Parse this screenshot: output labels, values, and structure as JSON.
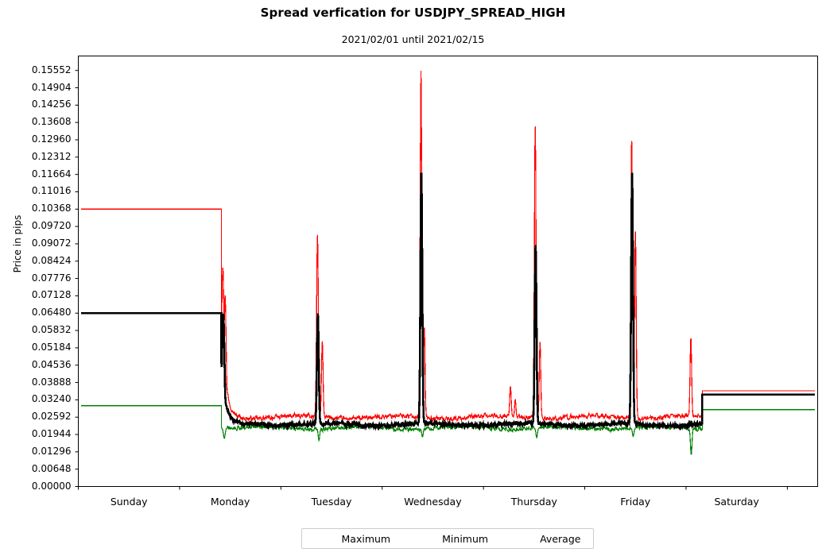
{
  "chart_data": {
    "type": "line",
    "title": "Spread verfication for USDJPY_SPREAD_HIGH",
    "subtitle": "2021/02/01 until 2021/02/15",
    "xlabel": "",
    "ylabel": "Price in pips",
    "grid": false,
    "legend_position": "below-center",
    "ylim": [
      0.0,
      0.16092
    ],
    "ytick_labels": [
      "0.15552",
      "0.14904",
      "0.14256",
      "0.13608",
      "0.12960",
      "0.12312",
      "0.11664",
      "0.11016",
      "0.10368",
      "0.09720",
      "0.09072",
      "0.08424",
      "0.07776",
      "0.07128",
      "0.06480",
      "0.05832",
      "0.05184",
      "0.04536",
      "0.03888",
      "0.03240",
      "0.02592",
      "0.01944",
      "0.01296",
      "0.00648",
      "0.00000"
    ],
    "ytick_values": [
      0.15552,
      0.14904,
      0.14256,
      0.13608,
      0.1296,
      0.12312,
      0.11664,
      0.11016,
      0.10368,
      0.0972,
      0.09072,
      0.08424,
      0.07776,
      0.07128,
      0.0648,
      0.05832,
      0.05184,
      0.04536,
      0.03888,
      0.0324,
      0.02592,
      0.01944,
      0.01296,
      0.00648,
      0.0
    ],
    "xtick_labels": [
      "Sunday",
      "Monday",
      "Tuesday",
      "Wednesday",
      "Thursday",
      "Friday",
      "Saturday"
    ],
    "xtick_boundaries": [
      0.0,
      0.137,
      0.274,
      0.411,
      0.548,
      0.685,
      0.822,
      0.959
    ],
    "series": [
      {
        "name": "Maximum",
        "color": "#ff0000",
        "width": 1.2,
        "baseline": 0.0259,
        "noise": 0.0013,
        "weekend_start_level": 0.10368,
        "weekend_end_level": 0.0358,
        "peaks": [
          {
            "x": 0.1955,
            "y": 0.082,
            "w": 0.0022
          },
          {
            "x": 0.1985,
            "y": 0.0715,
            "w": 0.002
          },
          {
            "x": 0.3235,
            "y": 0.0944,
            "w": 0.0016
          },
          {
            "x": 0.33,
            "y": 0.0545,
            "w": 0.0014
          },
          {
            "x": 0.4635,
            "y": 0.15552,
            "w": 0.0015
          },
          {
            "x": 0.468,
            "y": 0.0596,
            "w": 0.0013
          },
          {
            "x": 0.5845,
            "y": 0.0375,
            "w": 0.0014
          },
          {
            "x": 0.591,
            "y": 0.0327,
            "w": 0.0012
          },
          {
            "x": 0.618,
            "y": 0.13608,
            "w": 0.0015
          },
          {
            "x": 0.6245,
            "y": 0.0545,
            "w": 0.0013
          },
          {
            "x": 0.7485,
            "y": 0.1311,
            "w": 0.0015
          },
          {
            "x": 0.7535,
            "y": 0.0957,
            "w": 0.0014
          },
          {
            "x": 0.8285,
            "y": 0.0558,
            "w": 0.0014
          }
        ]
      },
      {
        "name": "Minimum",
        "color": "#008000",
        "width": 1.2,
        "baseline": 0.0219,
        "noise": 0.0012,
        "weekend_start_level": 0.0302,
        "weekend_end_level": 0.0287,
        "dips": [
          {
            "x": 0.1975,
            "y": 0.018,
            "w": 0.0016
          },
          {
            "x": 0.3255,
            "y": 0.0172,
            "w": 0.0014
          },
          {
            "x": 0.4655,
            "y": 0.0185,
            "w": 0.0014
          },
          {
            "x": 0.62,
            "y": 0.0183,
            "w": 0.0014
          },
          {
            "x": 0.7505,
            "y": 0.0187,
            "w": 0.0014
          },
          {
            "x": 0.829,
            "y": 0.0118,
            "w": 0.0014
          }
        ]
      },
      {
        "name": "Average",
        "color": "#000000",
        "width": 2.6,
        "baseline": 0.0232,
        "noise": 0.001,
        "weekend_start_level": 0.0648,
        "weekend_end_level": 0.0344,
        "peaks": [
          {
            "x": 0.196,
            "y": 0.0648,
            "w": 0.0022
          },
          {
            "x": 0.324,
            "y": 0.0648,
            "w": 0.0016
          },
          {
            "x": 0.464,
            "y": 0.1175,
            "w": 0.0016
          },
          {
            "x": 0.6185,
            "y": 0.09072,
            "w": 0.0016
          },
          {
            "x": 0.749,
            "y": 0.1187,
            "w": 0.0016
          }
        ]
      }
    ],
    "session_start_x": 0.1935,
    "session_end_x": 0.844
  },
  "legend": {
    "entries": [
      {
        "label": "Maximum",
        "color": "#ff0000"
      },
      {
        "label": "Minimum",
        "color": "#008000"
      },
      {
        "label": "Average",
        "color": "#000000"
      }
    ]
  },
  "axes": {
    "frame_color": "#000000"
  }
}
